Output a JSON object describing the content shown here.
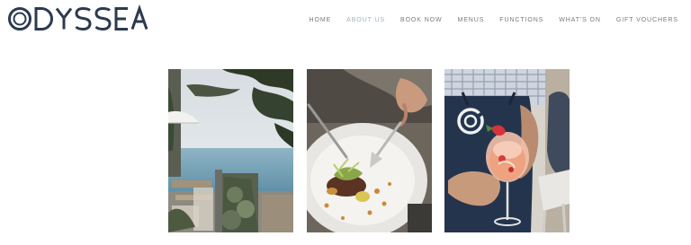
{
  "brand": {
    "name": "ODYSSEA",
    "logo_color": "#2c3a4f"
  },
  "nav": {
    "items": [
      {
        "label": "HOME",
        "active": false
      },
      {
        "label": "ABOUT US",
        "active": true
      },
      {
        "label": "BOOK NOW",
        "active": false
      },
      {
        "label": "MENUS",
        "active": false
      },
      {
        "label": "FUNCTIONS",
        "active": false
      },
      {
        "label": "WHAT'S ON",
        "active": false
      },
      {
        "label": "GIFT VOUCHERS",
        "active": false
      }
    ],
    "text_color": "#7a7a7a",
    "active_color": "#9fb2c6"
  },
  "gallery": {
    "photos": [
      {
        "subject": "beach-terrace-view"
      },
      {
        "subject": "plated-dish-with-fork"
      },
      {
        "subject": "waiter-holding-cocktail"
      }
    ]
  }
}
